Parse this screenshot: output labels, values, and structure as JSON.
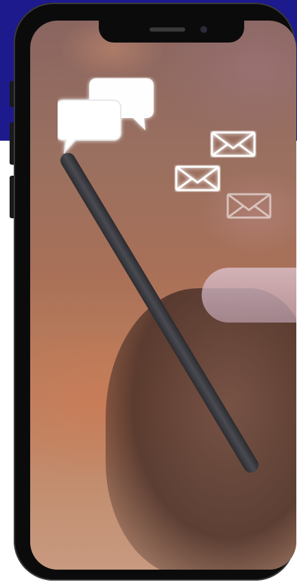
{
  "image": {
    "subject": "smartphone-mockup",
    "icons": [
      "chat-bubbles-icon",
      "envelope-icon",
      "envelope-icon",
      "envelope-icon"
    ]
  },
  "colors": {
    "background_band": "#1d1a8e",
    "phone_frame": "#0b0b0b",
    "icon_glow": "#ffffff"
  }
}
